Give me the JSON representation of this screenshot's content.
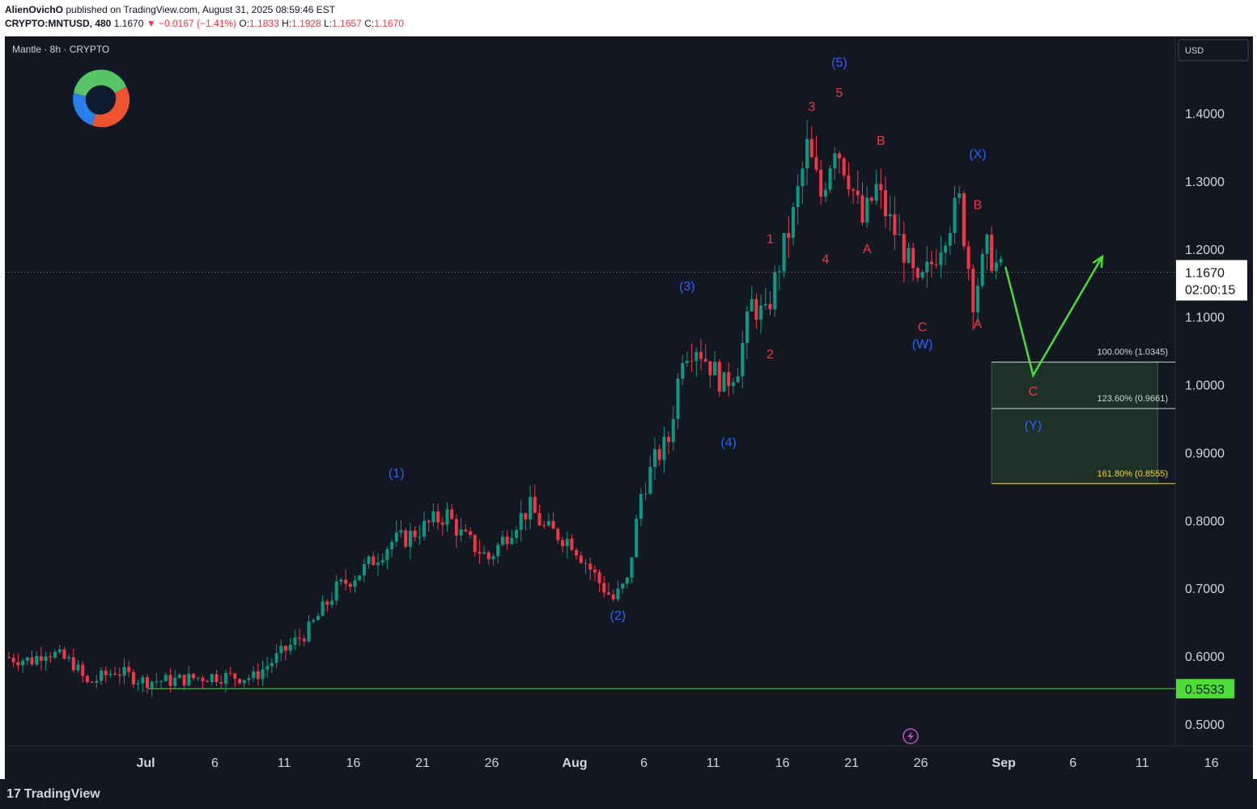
{
  "header": {
    "author": "AlienOvichO",
    "published_text": "published on TradingView.com, August 31, 2025 08:59:46 EST",
    "symbol": "CRYPTO:MNTUSD, 480",
    "last": "1.1670",
    "change": "▼ −0.0167 (−1.41%)",
    "o_label": "O:",
    "o_value": "1.1833",
    "h_label": "H:",
    "h_value": "1.1928",
    "l_label": "L:",
    "l_value": "1.1657",
    "c_label": "C:",
    "c_value": "1.1670"
  },
  "chart_title": "Mantle · 8h · CRYPTO",
  "currency": "USD",
  "footer": {
    "brand": "TradingView",
    "brand_mark": "17"
  },
  "colors": {
    "background": "#131722",
    "up": "#089981",
    "down": "#f23645",
    "axis_text": "#d1d4dc",
    "wave_blue": "#2962ff",
    "wave_red": "#f23645",
    "projection": "#4cdd36",
    "support": "#4cdd36",
    "fib_zone": "#1e3a2a",
    "fib_line": "#d1d4dc",
    "fib_gold": "#f5d33f"
  },
  "chart_data": {
    "type": "candlestick",
    "y_axis": {
      "min": 0.45,
      "max": 1.5,
      "ticks": [
        "1.4000",
        "1.3000",
        "1.2000",
        "1.1000",
        "1.0000",
        "0.9000",
        "0.8000",
        "0.7000",
        "0.6000",
        "0.5000"
      ]
    },
    "x_axis": {
      "start": "2025-06-21",
      "ticks": [
        {
          "date": "2025-07-01",
          "label": "Jul",
          "bold": true
        },
        {
          "date": "2025-07-06",
          "label": "6"
        },
        {
          "date": "2025-07-11",
          "label": "11"
        },
        {
          "date": "2025-07-16",
          "label": "16"
        },
        {
          "date": "2025-07-21",
          "label": "21"
        },
        {
          "date": "2025-07-26",
          "label": "26"
        },
        {
          "date": "2025-08-01",
          "label": "Aug",
          "bold": true
        },
        {
          "date": "2025-08-06",
          "label": "6"
        },
        {
          "date": "2025-08-11",
          "label": "11"
        },
        {
          "date": "2025-08-16",
          "label": "16"
        },
        {
          "date": "2025-08-21",
          "label": "21"
        },
        {
          "date": "2025-08-26",
          "label": "26"
        },
        {
          "date": "2025-09-01",
          "label": "Sep",
          "bold": true
        },
        {
          "date": "2025-09-06",
          "label": "6"
        },
        {
          "date": "2025-09-11",
          "label": "11"
        },
        {
          "date": "2025-09-16",
          "label": "16"
        }
      ]
    },
    "price_path": [
      {
        "t": "2025-06-21",
        "p": 0.6
      },
      {
        "t": "2025-06-23",
        "p": 0.595
      },
      {
        "t": "2025-06-24",
        "p": 0.61
      },
      {
        "t": "2025-06-26",
        "p": 0.59
      },
      {
        "t": "2025-06-27",
        "p": 0.56
      },
      {
        "t": "2025-06-29",
        "p": 0.58
      },
      {
        "t": "2025-07-01",
        "p": 0.565
      },
      {
        "t": "2025-07-03",
        "p": 0.565
      },
      {
        "t": "2025-07-06",
        "p": 0.572
      },
      {
        "t": "2025-07-09",
        "p": 0.57
      },
      {
        "t": "2025-07-11",
        "p": 0.605
      },
      {
        "t": "2025-07-13",
        "p": 0.64
      },
      {
        "t": "2025-07-15",
        "p": 0.7
      },
      {
        "t": "2025-07-17",
        "p": 0.73
      },
      {
        "t": "2025-07-19",
        "p": 0.77
      },
      {
        "t": "2025-07-20",
        "p": 0.775
      },
      {
        "t": "2025-07-22",
        "p": 0.8
      },
      {
        "t": "2025-07-23",
        "p": 0.81
      },
      {
        "t": "2025-07-24",
        "p": 0.78
      },
      {
        "t": "2025-07-26",
        "p": 0.745
      },
      {
        "t": "2025-07-28",
        "p": 0.8
      },
      {
        "t": "2025-07-29",
        "p": 0.82
      },
      {
        "t": "2025-07-30",
        "p": 0.79
      },
      {
        "t": "2025-08-01",
        "p": 0.77
      },
      {
        "t": "2025-08-03",
        "p": 0.71
      },
      {
        "t": "2025-08-04",
        "p": 0.685
      },
      {
        "t": "2025-08-05",
        "p": 0.71
      },
      {
        "t": "2025-08-06",
        "p": 0.84
      },
      {
        "t": "2025-08-07",
        "p": 0.89
      },
      {
        "t": "2025-08-08",
        "p": 0.92
      },
      {
        "t": "2025-08-09",
        "p": 1.05
      },
      {
        "t": "2025-08-10",
        "p": 1.06
      },
      {
        "t": "2025-08-11",
        "p": 1.03
      },
      {
        "t": "2025-08-12",
        "p": 1.0
      },
      {
        "t": "2025-08-13",
        "p": 1.03
      },
      {
        "t": "2025-08-14",
        "p": 1.12
      },
      {
        "t": "2025-08-15",
        "p": 1.1
      },
      {
        "t": "2025-08-16",
        "p": 1.18
      },
      {
        "t": "2025-08-17",
        "p": 1.25
      },
      {
        "t": "2025-08-18",
        "p": 1.35
      },
      {
        "t": "2025-08-19",
        "p": 1.28
      },
      {
        "t": "2025-08-20",
        "p": 1.36
      },
      {
        "t": "2025-08-21",
        "p": 1.31
      },
      {
        "t": "2025-08-22",
        "p": 1.24
      },
      {
        "t": "2025-08-23",
        "p": 1.29
      },
      {
        "t": "2025-08-24",
        "p": 1.24
      },
      {
        "t": "2025-08-25",
        "p": 1.2
      },
      {
        "t": "2025-08-26",
        "p": 1.14
      },
      {
        "t": "2025-08-27",
        "p": 1.18
      },
      {
        "t": "2025-08-28",
        "p": 1.23
      },
      {
        "t": "2025-08-29",
        "p": 1.27
      },
      {
        "t": "2025-08-30",
        "p": 1.13
      },
      {
        "t": "2025-08-31",
        "p": 1.2
      },
      {
        "t": "2025-09-01",
        "p": 1.167
      }
    ],
    "current_price": {
      "value": "1.1670",
      "countdown": "02:00:15"
    },
    "support_level": {
      "value": "0.5533",
      "from": "2025-07-01"
    },
    "projection_path": [
      {
        "t": "2025-09-01",
        "p": 1.175
      },
      {
        "t": "2025-09-03",
        "p": 1.015
      },
      {
        "t": "2025-09-08",
        "p": 1.19
      }
    ],
    "fib_box": {
      "from": "2025-08-31",
      "to": "2025-09-12",
      "levels": [
        {
          "label": "100.00% (1.0345)",
          "value": 1.0345,
          "color": "#d1d4dc"
        },
        {
          "label": "123.60% (0.9661)",
          "value": 0.9661,
          "color": "#d1d4dc"
        },
        {
          "label": "161.80% (0.8555)",
          "value": 0.8555,
          "color": "#f5d33f"
        }
      ]
    },
    "wave_labels": [
      {
        "text": "(1)",
        "t": "2025-07-19",
        "p": 0.865,
        "color": "blue"
      },
      {
        "text": "(2)",
        "t": "2025-08-04",
        "p": 0.655,
        "color": "blue"
      },
      {
        "text": "(3)",
        "t": "2025-08-09",
        "p": 1.14,
        "color": "blue"
      },
      {
        "text": "(4)",
        "t": "2025-08-12",
        "p": 0.91,
        "color": "blue"
      },
      {
        "text": "(5)",
        "t": "2025-08-20",
        "p": 1.47,
        "color": "blue"
      },
      {
        "text": "1",
        "t": "2025-08-15",
        "p": 1.21,
        "color": "red"
      },
      {
        "text": "2",
        "t": "2025-08-15",
        "p": 1.04,
        "color": "red"
      },
      {
        "text": "3",
        "t": "2025-08-18",
        "p": 1.405,
        "color": "red"
      },
      {
        "text": "4",
        "t": "2025-08-19",
        "p": 1.18,
        "color": "red"
      },
      {
        "text": "5",
        "t": "2025-08-20",
        "p": 1.425,
        "color": "red"
      },
      {
        "text": "A",
        "t": "2025-08-22",
        "p": 1.195,
        "color": "red"
      },
      {
        "text": "B",
        "t": "2025-08-23",
        "p": 1.355,
        "color": "red"
      },
      {
        "text": "C",
        "t": "2025-08-26",
        "p": 1.08,
        "color": "red"
      },
      {
        "text": "(W)",
        "t": "2025-08-26",
        "p": 1.055,
        "color": "blue"
      },
      {
        "text": "(X)",
        "t": "2025-08-30",
        "p": 1.335,
        "color": "blue"
      },
      {
        "text": "A",
        "t": "2025-08-30",
        "p": 1.085,
        "color": "red"
      },
      {
        "text": "B",
        "t": "2025-08-30",
        "p": 1.26,
        "color": "red"
      },
      {
        "text": "C",
        "t": "2025-09-03",
        "p": 0.985,
        "color": "red"
      },
      {
        "text": "(Y)",
        "t": "2025-09-03",
        "p": 0.935,
        "color": "blue"
      }
    ]
  }
}
